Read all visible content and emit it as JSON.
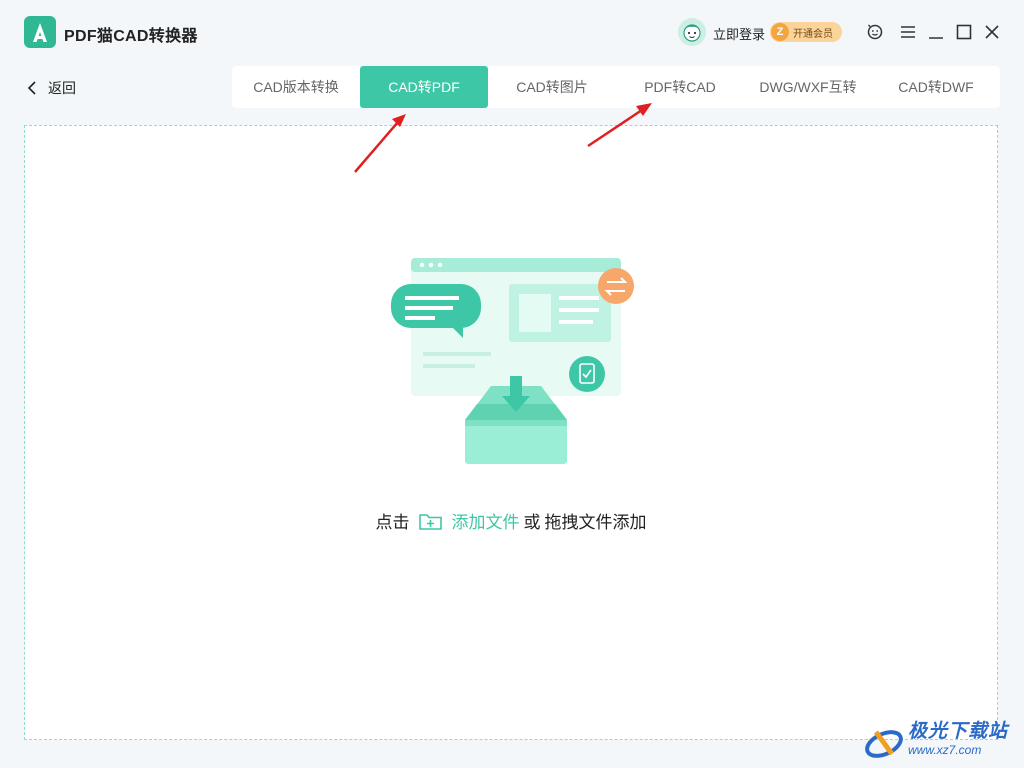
{
  "app": {
    "title": "PDF猫CAD转换器"
  },
  "header": {
    "login_label": "立即登录",
    "vip_icon_text": "Z",
    "vip_label": "开通会员"
  },
  "nav": {
    "back_label": "返回"
  },
  "tabs": [
    {
      "label": "CAD版本转换",
      "active": false
    },
    {
      "label": "CAD转PDF",
      "active": true
    },
    {
      "label": "CAD转图片",
      "active": false
    },
    {
      "label": "PDF转CAD",
      "active": false
    },
    {
      "label": "DWG/WXF互转",
      "active": false
    },
    {
      "label": "CAD转DWF",
      "active": false
    }
  ],
  "dropzone": {
    "prefix": "点击",
    "add_file_label": "添加文件",
    "middle": "或",
    "suffix": "拖拽文件添加"
  },
  "watermark": {
    "text": "极光下载站",
    "url": "www.xz7.com"
  },
  "colors": {
    "accent": "#3ec7a6",
    "annotation_arrow": "#e02020",
    "vip_badge": "#fbd49a"
  }
}
